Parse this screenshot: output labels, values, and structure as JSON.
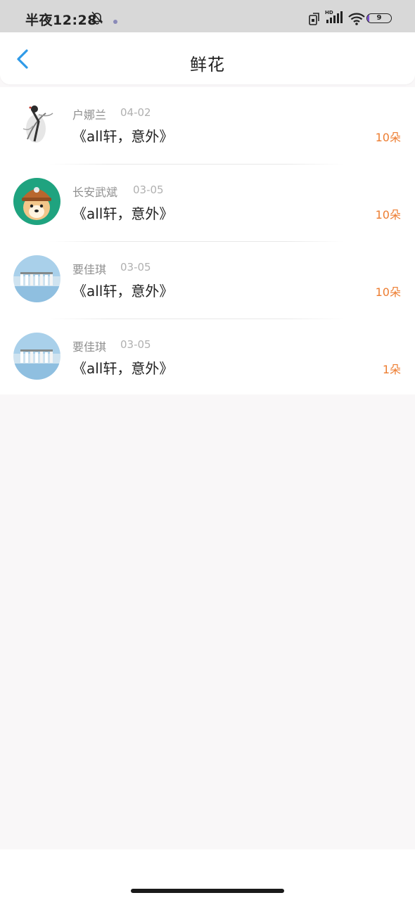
{
  "status_bar": {
    "time": "半夜12:28",
    "battery_level": "9",
    "battery_fraction": 0.09,
    "icons": [
      "bell-off-icon",
      "notification-dot-icon",
      "screen-rotate-icon",
      "hd-signal-icon",
      "wifi-icon",
      "battery-icon"
    ]
  },
  "header": {
    "title": "鲜花",
    "back_icon": "chevron-left-icon",
    "accent_color": "#2f9ae8"
  },
  "list": {
    "count_color": "#ed7d31",
    "items": [
      {
        "user": "户娜兰",
        "date": "04-02",
        "book": "《all轩，意外》",
        "count": "10朵",
        "avatar": "ink-painting-figure"
      },
      {
        "user": "长安武斌",
        "date": "03-05",
        "book": "《all轩，意外》",
        "count": "10朵",
        "avatar": "shiba-dog-helmet"
      },
      {
        "user": "要佳琪",
        "date": "03-05",
        "book": "《all轩，意外》",
        "count": "10朵",
        "avatar": "beach-group-photo"
      },
      {
        "user": "要佳琪",
        "date": "03-05",
        "book": "《all轩，意外》",
        "count": "1朵",
        "avatar": "beach-group-photo"
      }
    ]
  }
}
